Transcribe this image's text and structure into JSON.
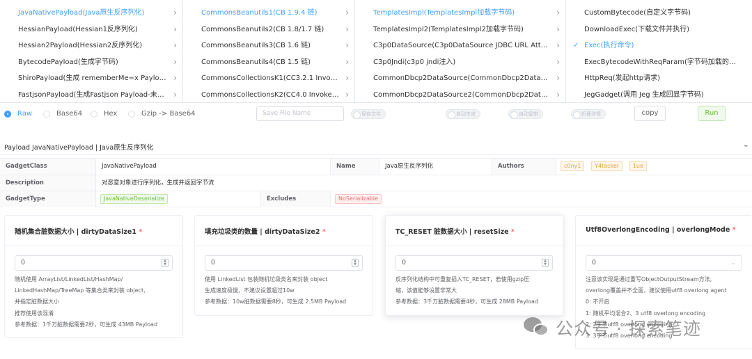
{
  "cascader": {
    "col1": [
      {
        "label": "JavaNativePayload(Java原生反序列化)",
        "active": true
      },
      {
        "label": "HessianPayload(Hessian1反序列化)",
        "active": false
      },
      {
        "label": "Hessian2Payload(Hessian2反序列化)",
        "active": false
      },
      {
        "label": "BytecodePayload(生成字节码)",
        "active": false
      },
      {
        "label": "ShiroPayload(生成 rememberMe=x Payload)",
        "active": false
      },
      {
        "label": "FastjsonPayload(生成Fastjson Payload-未测试)",
        "active": false
      }
    ],
    "col2": [
      {
        "label": "CommonsBeanutils1(CB 1.9.4 链)",
        "active": true
      },
      {
        "label": "CommonsBeanutils2(CB 1.8/1.7 链)",
        "active": false
      },
      {
        "label": "CommonsBeanutils3(CB 1.6 链)",
        "active": false
      },
      {
        "label": "CommonsBeanutils4(CB 1.5 链)",
        "active": false
      },
      {
        "label": "CommonsCollectionsK1(CC3.2.1 InvokerTr...",
        "active": false
      },
      {
        "label": "CommonsCollectionsK2(CC4.0 InvokerTra...",
        "active": false
      }
    ],
    "col3": [
      {
        "label": "TemplatesImpl(TemplatesImpl加载字节码)",
        "active": true
      },
      {
        "label": "TemplatesImpl2(TemplatesImpl2加载字节码)",
        "active": false
      },
      {
        "label": "C3p0DataSource(C3p0DataSource JDBC URL Attack)",
        "active": false
      },
      {
        "label": "C3p0Jndi(c3p0 jndi注入)",
        "active": false
      },
      {
        "label": "CommonDbcp2DataSource(CommonDbcp2DataSource...",
        "active": false
      },
      {
        "label": "CommonDbcp2DataSource2(CommonDbcp2DataSourc...",
        "active": false
      }
    ],
    "col4": [
      {
        "label": "CustomBytecode(自定义字节码)",
        "active": false
      },
      {
        "label": "DownloadExec(下载文件并执行)",
        "active": false
      },
      {
        "label": "Exec(执行命令)",
        "active": true
      },
      {
        "label": "ExecBytecodeWithReqParam(字节码加载的小马)",
        "active": false
      },
      {
        "label": "HttpReq(发起http请求)",
        "active": false
      },
      {
        "label": "JegGadget(调用 Jeg 生成回显字节码)",
        "active": false
      }
    ]
  },
  "encoding": {
    "raw": "Raw",
    "base64": "Base64",
    "hex": "Hex",
    "gzip": "Gzip -> Base64"
  },
  "file_name_placeholder": "Save File Name",
  "switches": {
    "save_file": "保存文件",
    "auto_generate": "自动生成",
    "auto_copy": "自动复制",
    "fold_detail": "折叠详情"
  },
  "buttons": {
    "copy": "copy",
    "run": "Run"
  },
  "panel_title": "Payload JavaNativePayload | Java原生反序列化",
  "details": {
    "gadget_class_label": "GadgetClass",
    "gadget_class_value": "JavaNativePayload",
    "name_label": "Name",
    "name_value": "Java原生反序列化",
    "authors_label": "Authors",
    "authors": [
      "c0ny1",
      "Y4tacker",
      "1ue"
    ],
    "description_label": "Description",
    "description_value": "对恶意对象进行序列化，生成并返回字节流",
    "gadget_type_label": "GadgetType",
    "gadget_type_value": "JavaNativeDeserialize",
    "excludes_label": "Excludes",
    "excludes_value": "NoSerializable"
  },
  "params": [
    {
      "title": "随机集合脏数据大小 | dirtyDataSize1",
      "required": "*",
      "value": "0",
      "help": [
        "随机使用 ArrayList/LinkedList/HashMap/",
        "LinkedHashMap/TreeMap 等集合类来封装 object,",
        "并指定脏数据大小",
        "推荐使用该混淆",
        "参考数据：1千万脏数据需要2秒，可生成 43MB Payload"
      ]
    },
    {
      "title": "填充垃圾类的数量 | dirtyDataSize2",
      "required": "*",
      "value": "0",
      "help": [
        "使用 LinkedList 包装随机垃圾类名来封装 object",
        "生成速度极慢，不建议设置超过10w",
        "参考数据：10w脏数据需要8秒，可生成 2.5MB Payload"
      ]
    },
    {
      "title": "TC_RESET 脏数据大小 | resetSize",
      "required": "*",
      "value": "0",
      "help": [
        "反序列化结构中可重复插入TC_RESET，若使用gzip压",
        "缩，该值能够设置非常大",
        "参考数据：3千万脏数据需要4秒，可生成 28MB Payload"
      ]
    },
    {
      "title": "Utf8OverlongEncoding | overlongMode",
      "required": "*",
      "value": "0",
      "help": [
        "注意该实现是通过重写ObjectOutputStream方法,",
        "overlong覆盖并不全面，建议使用utf8 overlong agent",
        "0: 不开启",
        "1: 随机平均混合2、3 utf8 overlong encoding",
        "2: 2字节utf8 overlong encoding",
        "3: 3字节utf8 overlong encoding"
      ]
    }
  ],
  "watermark": "公众号 · 探索笔迹"
}
